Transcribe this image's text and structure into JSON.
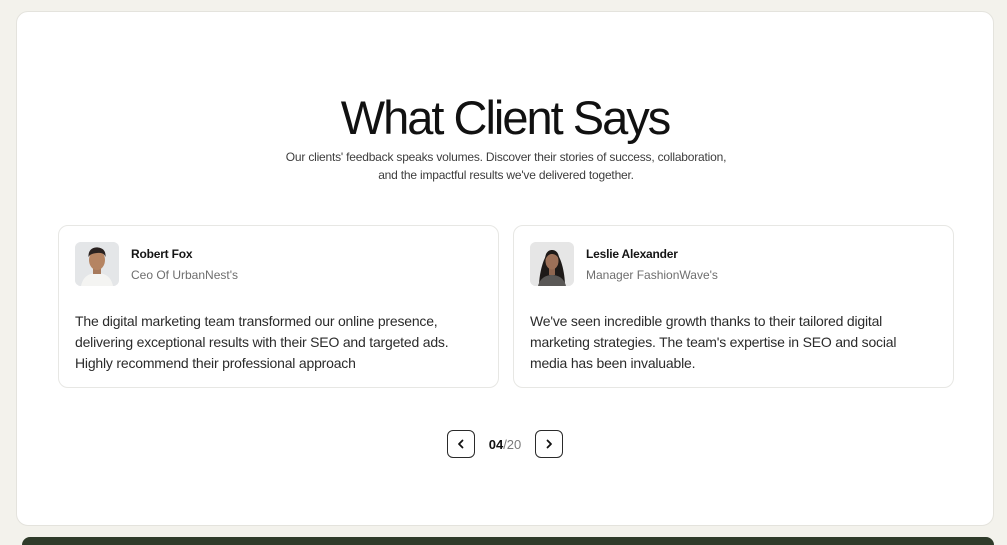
{
  "header": {
    "title": "What Client Says",
    "subtitle_line1": "Our clients' feedback speaks volumes. Discover their stories of success, collaboration,",
    "subtitle_line2": "and the impactful results we've delivered together."
  },
  "testimonials": [
    {
      "name": "Robert Fox",
      "role": "Ceo Of UrbanNest's",
      "quote": "The digital marketing team transformed our online presence, delivering exceptional results with their SEO and targeted ads. Highly recommend their professional approach",
      "avatar_icon": "avatar-man-photo"
    },
    {
      "name": "Leslie Alexander",
      "role": "Manager FashionWave's",
      "quote": "We've seen incredible growth thanks to their tailored digital marketing strategies. The team's expertise in SEO and social media has been invaluable.",
      "avatar_icon": "avatar-woman-photo"
    }
  ],
  "pagination": {
    "current": "04",
    "total": "/20",
    "prev_icon": "chevron-left-icon",
    "next_icon": "chevron-right-icon"
  },
  "colors": {
    "page_background": "#f3f2ec",
    "card_border": "#e7e7e4",
    "footer_accent": "#2f3b2a"
  }
}
